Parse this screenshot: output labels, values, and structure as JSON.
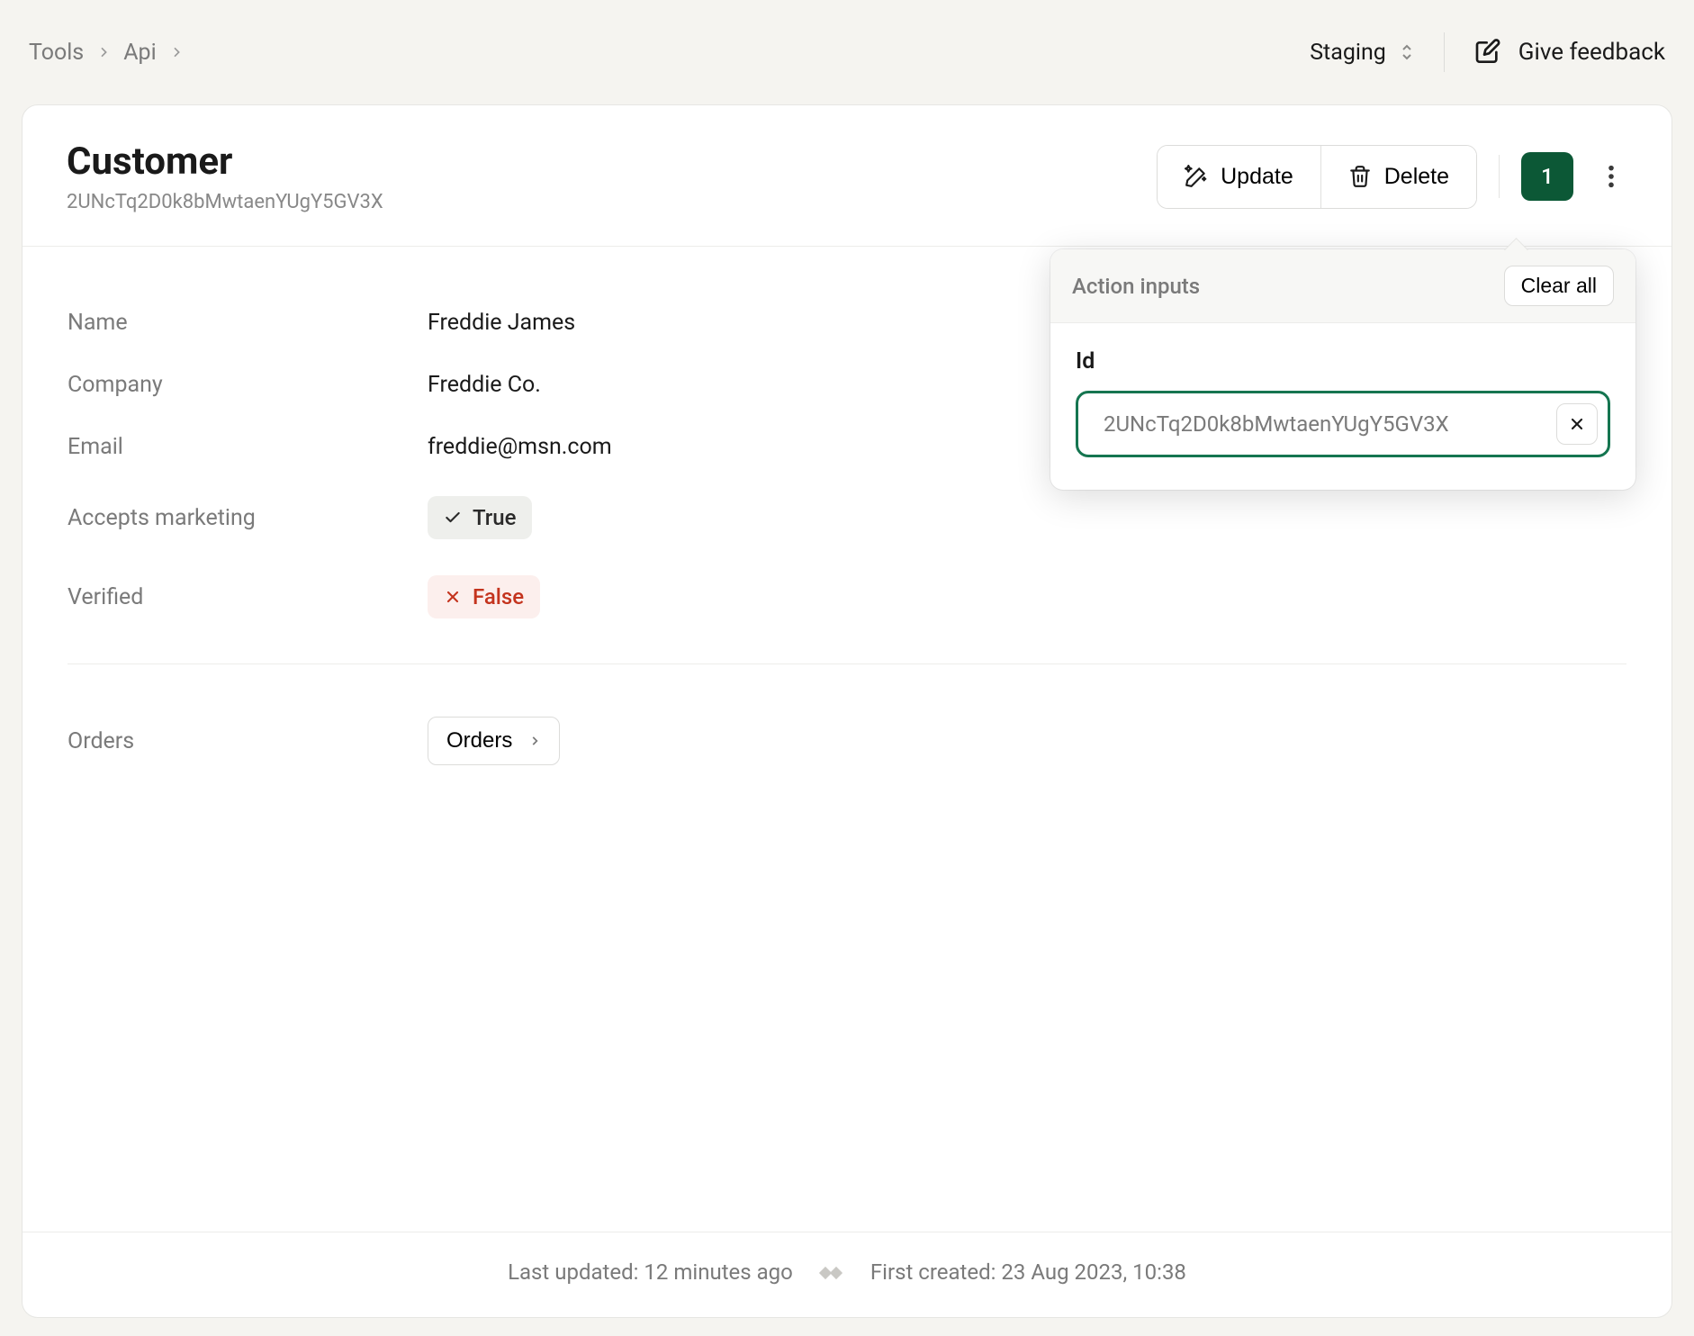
{
  "breadcrumbs": {
    "items": [
      "Tools",
      "Api"
    ]
  },
  "header": {
    "environment_label": "Staging",
    "feedback_label": "Give feedback"
  },
  "page": {
    "title": "Customer",
    "subtitle": "2UNcTq2D0k8bMwtaenYUgY5GV3X"
  },
  "actions": {
    "update_label": "Update",
    "delete_label": "Delete",
    "count_badge": "1"
  },
  "fields": {
    "name": {
      "label": "Name",
      "value": "Freddie James"
    },
    "company": {
      "label": "Company",
      "value": "Freddie Co."
    },
    "email": {
      "label": "Email",
      "value": "freddie@msn.com"
    },
    "accepts_marketing": {
      "label": "Accepts marketing",
      "value": "True"
    },
    "verified": {
      "label": "Verified",
      "value": "False"
    },
    "orders": {
      "label": "Orders",
      "button_label": "Orders"
    }
  },
  "popover": {
    "title": "Action inputs",
    "clear_all_label": "Clear all",
    "field_label": "Id",
    "input_value": "2UNcTq2D0k8bMwtaenYUgY5GV3X"
  },
  "footer": {
    "last_updated": "Last updated: 12 minutes ago",
    "first_created": "First created: 23 Aug 2023, 10:38"
  },
  "colors": {
    "accent_green": "#157550",
    "badge_green": "#0c5836",
    "danger_red": "#c4341e"
  }
}
